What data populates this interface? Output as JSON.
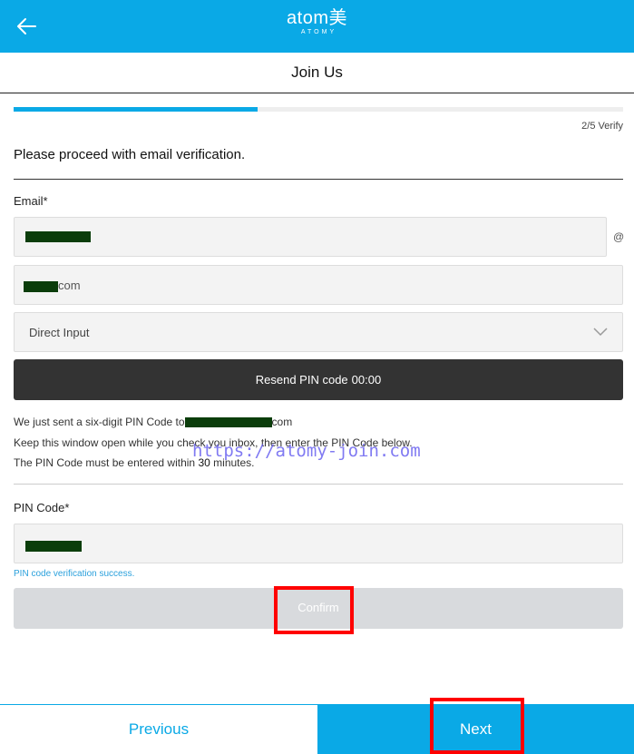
{
  "header": {
    "logo_main": "atom美",
    "logo_sub": "ATOMY",
    "back_icon": "back-arrow-icon",
    "color": "#0aa9e6"
  },
  "title": "Join Us",
  "progress": {
    "fraction": 0.4,
    "step_label": "2/5 Verify"
  },
  "instruction": "Please proceed with email verification.",
  "email": {
    "label": "Email*",
    "at_sign": "@",
    "domain_suffix": "com",
    "domain_select": "Direct Input",
    "chevron_icon": "chevron-down-icon"
  },
  "resend": {
    "label": "Resend PIN code",
    "timer": "00:00"
  },
  "notice": {
    "line1_prefix": "We just sent a six-digit PIN Code to",
    "line1_suffix": "com",
    "line2": "Keep this window open while you check you inbox, then enter the PIN Code below.",
    "line3_prefix": "The PIN Code must be entered within",
    "line3_number": "30",
    "line3_suffix": "minutes."
  },
  "watermark": "https://atomy-join.com",
  "pin": {
    "label": "PIN Code*",
    "success_message": "PIN code verification success."
  },
  "confirm_label": "Confirm",
  "nav": {
    "previous": "Previous",
    "next": "Next"
  },
  "colors": {
    "accent": "#0aa9e6",
    "highlight": "#ff0000",
    "dark_button": "#333333",
    "success_text": "#2aa0dc"
  }
}
